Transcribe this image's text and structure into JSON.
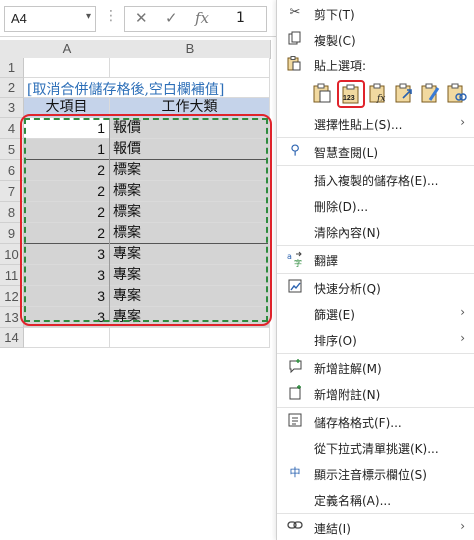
{
  "formula_bar": {
    "name_box": "A4",
    "cancel_symbol": "✕",
    "confirm_symbol": "✓",
    "fx_symbol": "fx",
    "value": "1"
  },
  "sheet": {
    "columns": [
      "A",
      "B"
    ],
    "rows": [
      "1",
      "2",
      "3",
      "4",
      "5",
      "6",
      "7",
      "8",
      "9",
      "10",
      "11",
      "12",
      "13",
      "14"
    ],
    "title": "[取消合併儲存格後,空白欄補值]",
    "header_a": "大項目",
    "header_b": "工作大類",
    "data": [
      {
        "a": "1",
        "b": "報價"
      },
      {
        "a": "1",
        "b": "報價"
      },
      {
        "a": "2",
        "b": "標案"
      },
      {
        "a": "2",
        "b": "標案"
      },
      {
        "a": "2",
        "b": "標案"
      },
      {
        "a": "2",
        "b": "標案"
      },
      {
        "a": "3",
        "b": "專案"
      },
      {
        "a": "3",
        "b": "專案"
      },
      {
        "a": "3",
        "b": "專案"
      },
      {
        "a": "3",
        "b": "專案"
      }
    ]
  },
  "menu": {
    "cut": "剪下(T)",
    "copy": "複製(C)",
    "paste_options": "貼上選項:",
    "paste_special": "選擇性貼上(S)...",
    "smart_lookup": "智慧查閱(L)",
    "insert_copied": "插入複製的儲存格(E)...",
    "delete": "刪除(D)...",
    "clear": "清除內容(N)",
    "translate": "翻譯",
    "quick_analysis": "快速分析(Q)",
    "filter": "篩選(E)",
    "sort": "排序(O)",
    "new_comment": "新增註解(M)",
    "new_note": "新增附註(N)",
    "format_cells": "儲存格格式(F)...",
    "pick_list": "從下拉式清單挑選(K)...",
    "phonetic": "顯示注音標示欄位(S)",
    "define_name": "定義名稱(A)...",
    "link": "連結(I)",
    "submenu_arrow": "›",
    "paste_value_caption": "123",
    "phonetic_icon_glyph": "中",
    "colors": {
      "highlight_red": "#e0232b",
      "marching_ants_green": "#2e8b3e",
      "title_blue": "#2d6fb8",
      "header_fill": "#c5d3ea"
    }
  }
}
